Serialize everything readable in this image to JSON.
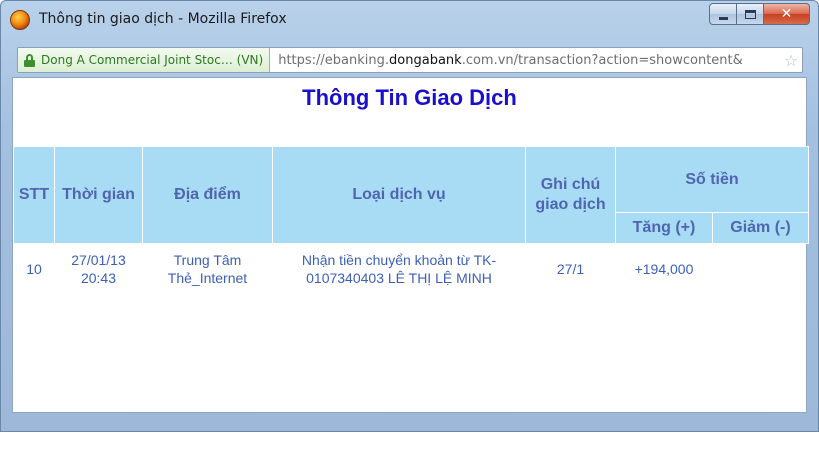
{
  "window": {
    "title": "Thông tin giao dịch - Mozilla Firefox"
  },
  "urlbar": {
    "identity": "Dong A Commercial Joint Stoc… (VN)",
    "url_prefix": "https://ebanking.",
    "url_domain": "dongabank",
    "url_suffix": ".com.vn/transaction?action=showcontent&"
  },
  "page": {
    "title": "Thông Tin Giao Dịch"
  },
  "table": {
    "headers": {
      "stt": "STT",
      "time": "Thời gian",
      "place": "Địa điểm",
      "service": "Loại dịch vụ",
      "note": "Ghi chú giao dịch",
      "amount": "Số tiền",
      "increase": "Tăng (+)",
      "decrease": "Giảm (-)"
    },
    "rows": [
      {
        "stt": "10",
        "time": "27/01/13 20:43",
        "place": "Trung Tâm Thẻ_Internet",
        "service": "Nhận tiền chuyển khoản từ TK-0107340403 LÊ THỊ LỆ MINH",
        "note": "27/1",
        "increase": "+194,000",
        "decrease": ""
      }
    ]
  }
}
